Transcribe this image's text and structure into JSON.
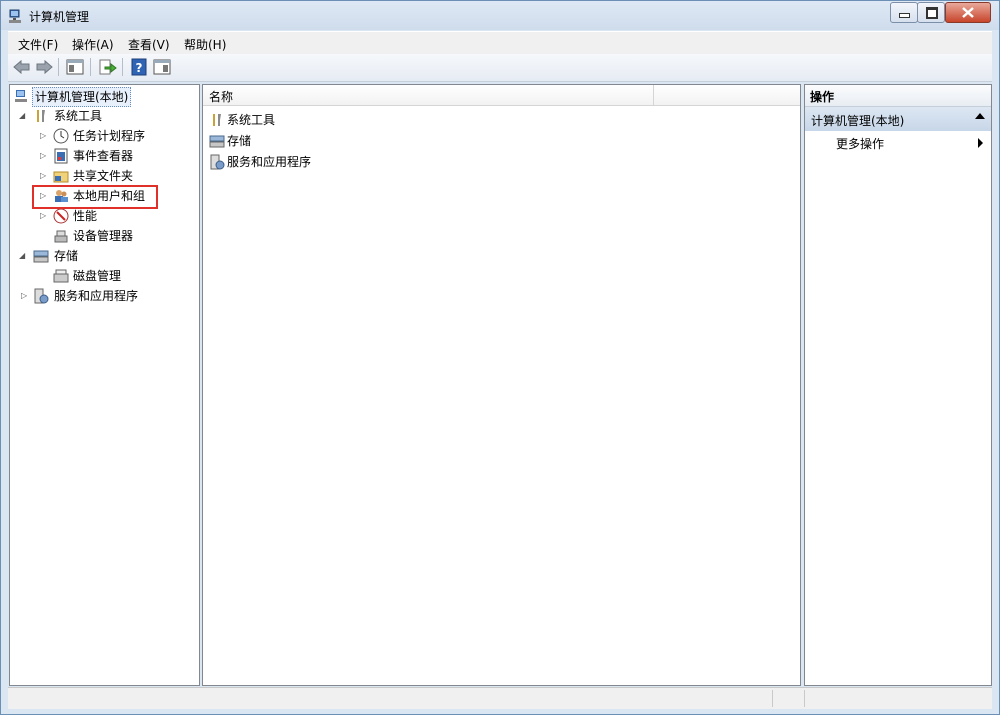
{
  "window": {
    "title": "计算机管理"
  },
  "menubar": {
    "items": [
      "文件(F)",
      "操作(A)",
      "查看(V)",
      "帮助(H)"
    ]
  },
  "toolbar": {
    "icons": [
      "back-arrow-icon",
      "forward-arrow-icon",
      "show-hide-tree-icon",
      "export-list-icon",
      "help-icon",
      "show-hide-action-pane-icon"
    ]
  },
  "tree": {
    "root": "计算机管理(本地)",
    "system_tools": "系统工具",
    "task_scheduler": "任务计划程序",
    "event_viewer": "事件查看器",
    "shared_folders": "共享文件夹",
    "local_users": "本地用户和组",
    "performance": "性能",
    "device_manager": "设备管理器",
    "storage": "存储",
    "disk_management": "磁盘管理",
    "services": "服务和应用程序"
  },
  "list": {
    "column_name": "名称",
    "items": [
      "系统工具",
      "存储",
      "服务和应用程序"
    ]
  },
  "actions": {
    "title": "操作",
    "section": "计算机管理(本地)",
    "more": "更多操作"
  },
  "colors": {
    "highlight": "#e0302a",
    "accent": "#c7d6e8"
  }
}
